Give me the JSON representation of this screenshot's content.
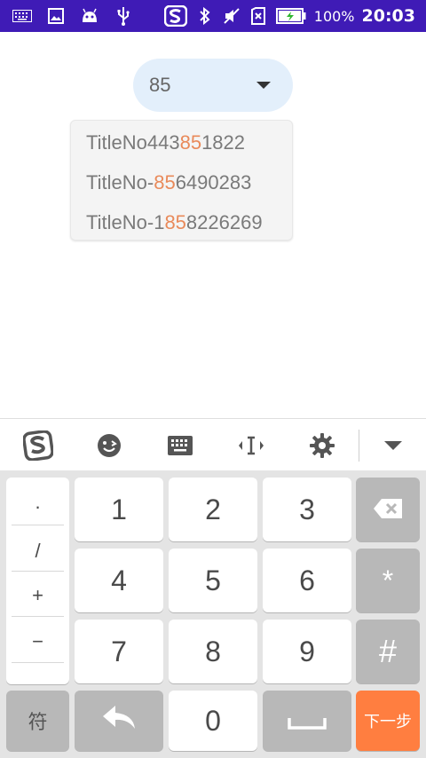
{
  "status_bar": {
    "battery_percent": "100%",
    "time": "20:03",
    "icons_left": [
      "keyboard-icon",
      "image-icon",
      "android-icon",
      "usb-icon"
    ],
    "icons_right": [
      "sogou-icon",
      "bluetooth-icon",
      "muted-icon",
      "sim-off-icon",
      "battery-charging-icon"
    ]
  },
  "search": {
    "value": "85"
  },
  "suggestions": [
    {
      "pre": "TitleNo443",
      "match": "85",
      "post": "1822"
    },
    {
      "pre": "TitleNo-",
      "match": "85",
      "post": "6490283"
    },
    {
      "pre": "TitleNo-1",
      "match": "85",
      "post": "8226269"
    }
  ],
  "keyboard": {
    "toolbar_icons": [
      "sogou-logo-icon",
      "emoji-icon",
      "keyboard-icon",
      "cursor-move-icon",
      "settings-icon",
      "collapse-icon"
    ],
    "symbols": [
      "·",
      "/",
      "+",
      "−"
    ],
    "digits": [
      "1",
      "2",
      "3",
      "4",
      "5",
      "6",
      "7",
      "8",
      "9",
      "0"
    ],
    "star": "*",
    "hash": "#",
    "symbol_key": "符",
    "next_key": "下一步"
  },
  "colors": {
    "status_bar": "#3f1bb6",
    "highlight": "#e98a5a",
    "next_key": "#ff7e40",
    "pill": "#e3effb"
  }
}
